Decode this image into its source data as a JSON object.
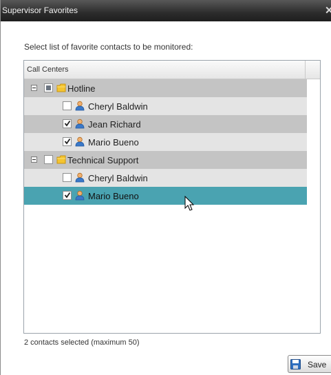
{
  "window": {
    "title": "Supervisor Favorites"
  },
  "instruction": "Select list of favorite contacts to be monitored:",
  "grid": {
    "column_header": "Call Centers",
    "groups": [
      {
        "name": "Hotline",
        "check_state": "partial",
        "contacts": [
          {
            "name": "Cheryl Baldwin",
            "checked": false
          },
          {
            "name": "Jean Richard",
            "checked": true
          },
          {
            "name": "Mario Bueno",
            "checked": true
          }
        ]
      },
      {
        "name": "Technical Support",
        "check_state": "unchecked",
        "contacts": [
          {
            "name": "Cheryl Baldwin",
            "checked": false
          },
          {
            "name": "Mario Bueno",
            "checked": true,
            "selected": true
          }
        ]
      }
    ]
  },
  "status": "2 contacts selected (maximum 50)",
  "save_button": {
    "label": "Save"
  },
  "colors": {
    "titlebar": "#2c2c2c",
    "selected_row": "#4aa3b1",
    "group_row": "#c4c4c4",
    "alt_row": "#e4e4e4",
    "folder": "#f4c430",
    "user_icon": "#e08a2a"
  },
  "icons": {
    "close": "close-icon",
    "expand": "collapse-icon",
    "folder": "folder-icon",
    "contact": "user-icon",
    "save": "floppy-disk-icon"
  }
}
